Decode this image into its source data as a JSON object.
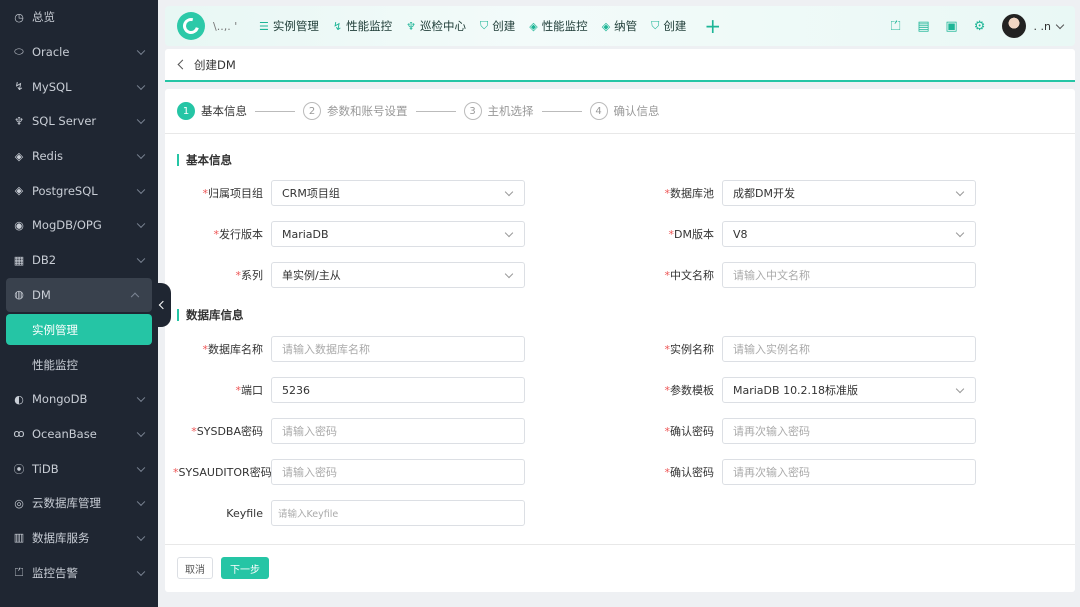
{
  "sidebar": {
    "items": [
      {
        "label": "总览",
        "icon": "dashboard-icon",
        "glyph": "◷",
        "chevron": false
      },
      {
        "label": "Oracle",
        "icon": "oracle-icon",
        "glyph": "⬭",
        "chevron": true
      },
      {
        "label": "MySQL",
        "icon": "mysql-icon",
        "glyph": "↯",
        "chevron": true
      },
      {
        "label": "SQL Server",
        "icon": "sqlserver-icon",
        "glyph": "♆",
        "chevron": true
      },
      {
        "label": "Redis",
        "icon": "redis-icon",
        "glyph": "◈",
        "chevron": true
      },
      {
        "label": "PostgreSQL",
        "icon": "postgresql-icon",
        "glyph": "◈",
        "chevron": true
      },
      {
        "label": "MogDB/OPG",
        "icon": "mogdb-icon",
        "glyph": "◉",
        "chevron": true
      },
      {
        "label": "DB2",
        "icon": "db2-icon",
        "glyph": "▦",
        "chevron": true
      }
    ],
    "open_item": {
      "label": "DM",
      "icon": "dm-icon",
      "glyph": "◍"
    },
    "sub_items": [
      {
        "label": "实例管理",
        "active": true
      },
      {
        "label": "性能监控",
        "active": false
      }
    ],
    "items_after": [
      {
        "label": "MongoDB",
        "icon": "mongodb-icon",
        "glyph": "◐",
        "chevron": true
      },
      {
        "label": "OceanBase",
        "icon": "oceanbase-icon",
        "glyph": "ꝏ",
        "chevron": true
      },
      {
        "label": "TiDB",
        "icon": "tidb-icon",
        "glyph": "⦿",
        "chevron": true
      },
      {
        "label": "云数据库管理",
        "icon": "cloud-db-icon",
        "glyph": "◎",
        "chevron": true
      },
      {
        "label": "数据库服务",
        "icon": "db-service-icon",
        "glyph": "▥",
        "chevron": true
      },
      {
        "label": "监控告警",
        "icon": "alarm-icon",
        "glyph": "⏍",
        "chevron": true
      }
    ]
  },
  "topbar": {
    "logo_text": "\\..,. '",
    "nav": [
      {
        "label": "实例管理",
        "icon": "list-icon",
        "glyph": "☰"
      },
      {
        "label": "性能监控",
        "icon": "monitor-icon",
        "glyph": "↯"
      },
      {
        "label": "巡检中心",
        "icon": "inspect-icon",
        "glyph": "♆"
      },
      {
        "label": "创建",
        "icon": "create-icon",
        "glyph": "⛉"
      },
      {
        "label": "性能监控",
        "icon": "layers-icon",
        "glyph": "◈"
      },
      {
        "label": "纳管",
        "icon": "manage-icon",
        "glyph": "◈"
      },
      {
        "label": "创建",
        "icon": "shield-icon",
        "glyph": "⛉"
      }
    ],
    "plus": "+",
    "right_icons": [
      {
        "name": "bell-icon",
        "glyph": "⏍"
      },
      {
        "name": "clipboard-icon",
        "glyph": "▤"
      },
      {
        "name": "screen-icon",
        "glyph": "▣"
      },
      {
        "name": "gear-icon",
        "glyph": "⚙"
      }
    ],
    "user": ". .n"
  },
  "breadcrumb": {
    "title": "创建DM"
  },
  "steps": [
    {
      "num": "1",
      "label": "基本信息",
      "active": true
    },
    {
      "num": "2",
      "label": "参数和账号设置",
      "active": false
    },
    {
      "num": "3",
      "label": "主机选择",
      "active": false
    },
    {
      "num": "4",
      "label": "确认信息",
      "active": false
    }
  ],
  "sections": {
    "basic": "基本信息",
    "db": "数据库信息"
  },
  "form": {
    "project_group": {
      "label": "归属项目组",
      "value": "CRM项目组"
    },
    "db_pool": {
      "label": "数据库池",
      "value": "成都DM开发"
    },
    "release_version": {
      "label": "发行版本",
      "value": "MariaDB"
    },
    "dm_version": {
      "label": "DM版本",
      "value": "V8"
    },
    "series": {
      "label": "系列",
      "value": "单实例/主从"
    },
    "cn_name": {
      "label": "中文名称",
      "placeholder": "请输入中文名称"
    },
    "db_name": {
      "label": "数据库名称",
      "placeholder": "请输入数据库名称"
    },
    "instance_name": {
      "label": "实例名称",
      "placeholder": "请输入实例名称"
    },
    "port": {
      "label": "端口",
      "value": "5236"
    },
    "param_template": {
      "label": "参数模板",
      "value": "MariaDB 10.2.18标准版"
    },
    "sysdba_pwd": {
      "label": "SYSDBA密码",
      "placeholder": "请输入密码"
    },
    "confirm_pwd_1": {
      "label": "确认密码",
      "placeholder": "请再次输入密码"
    },
    "sysauditor_pwd": {
      "label": "SYSAUDITOR密码",
      "placeholder": "请输入密码"
    },
    "confirm_pwd_2": {
      "label": "确认密码",
      "placeholder": "请再次输入密码"
    },
    "keyfile": {
      "label": "Keyfile",
      "placeholder": "请输入Keyfile"
    }
  },
  "buttons": {
    "cancel": "取消",
    "next": "下一步"
  },
  "colors": {
    "accent": "#25c5a5",
    "sidebar_bg": "#1f2632",
    "required": "#e55555"
  }
}
